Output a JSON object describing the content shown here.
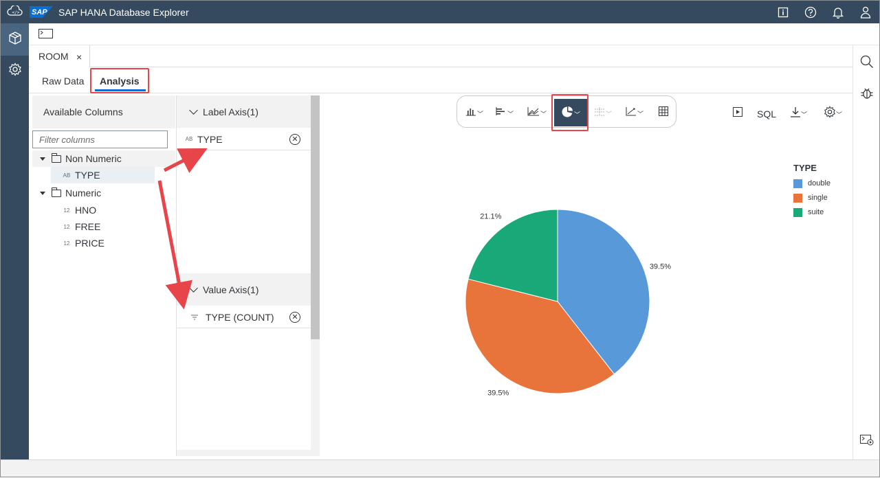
{
  "shell": {
    "title": "SAP HANA Database Explorer",
    "logo_text": "SAP",
    "icons": [
      "cloud-code-icon",
      "info-icon",
      "help-icon",
      "notification-bell-icon",
      "user-icon"
    ]
  },
  "leftnav": {
    "items": [
      "database-cubes-icon",
      "settings-gear-icon"
    ]
  },
  "toolbar": {
    "sql_console_label": "SQL"
  },
  "tab": {
    "label": "ROOM",
    "close": "×"
  },
  "subtabs": {
    "raw": "Raw Data",
    "analysis": "Analysis"
  },
  "available": {
    "header": "Available Columns",
    "filter_placeholder": "Filter columns",
    "groups": [
      {
        "label": "Non Numeric",
        "items": [
          {
            "type_icon": "AB",
            "label": "TYPE"
          }
        ]
      },
      {
        "label": "Numeric",
        "items": [
          {
            "type_icon": "12",
            "label": "HNO"
          },
          {
            "type_icon": "12",
            "label": "FREE"
          },
          {
            "type_icon": "12",
            "label": "PRICE"
          }
        ]
      }
    ]
  },
  "label_axis": {
    "header": "Label Axis(1)",
    "item": "TYPE",
    "item_icon": "AB"
  },
  "value_axis": {
    "header": "Value Axis(1)",
    "item": "TYPE (COUNT)"
  },
  "chart_toolbar": {
    "buttons": [
      "column-chart-icon",
      "bar-chart-icon",
      "line-chart-icon",
      "pie-chart-icon",
      "stacked-chart-icon",
      "scatter-chart-icon",
      "table-icon"
    ],
    "active": "pie-chart-icon",
    "sql_label": "SQL"
  },
  "colors": {
    "double": "#5899da",
    "single": "#e8743b",
    "suite": "#19a979",
    "highlight": "#e8454b",
    "shell": "#354a5f"
  },
  "chart_data": {
    "type": "pie",
    "legend_title": "TYPE",
    "legend_position": "top-right",
    "categories": [
      "double",
      "single",
      "suite"
    ],
    "values": [
      39.5,
      39.5,
      21.1
    ],
    "labels": [
      "39.5%",
      "39.5%",
      "21.1%"
    ]
  }
}
